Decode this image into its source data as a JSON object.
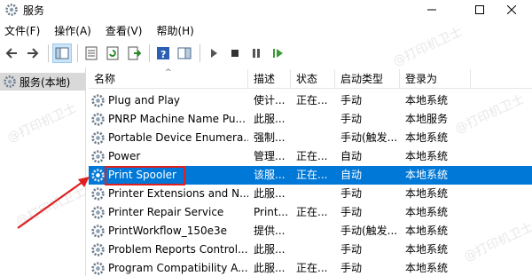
{
  "window": {
    "title": "服务"
  },
  "menubar": {
    "items": [
      "文件(F)",
      "操作(A)",
      "查看(V)",
      "帮助(H)"
    ]
  },
  "sidebar": {
    "selected": "服务(本地)"
  },
  "table": {
    "columns": [
      "名称",
      "描述",
      "状态",
      "启动类型",
      "登录为"
    ],
    "rows": [
      {
        "name": "Plug and Play",
        "desc": "使计...",
        "status": "正在...",
        "startup": "手动",
        "logon": "本地系统"
      },
      {
        "name": "PNRP Machine Name Pu...",
        "desc": "此服...",
        "status": "",
        "startup": "手动",
        "logon": "本地服务"
      },
      {
        "name": "Portable Device Enumera...",
        "desc": "强制...",
        "status": "",
        "startup": "手动(触发...",
        "logon": "本地系统"
      },
      {
        "name": "Power",
        "desc": "管理...",
        "status": "正在...",
        "startup": "自动",
        "logon": "本地系统"
      },
      {
        "name": "Print Spooler",
        "desc": "该服...",
        "status": "正在...",
        "startup": "自动",
        "logon": "本地系统",
        "selected": true
      },
      {
        "name": "Printer Extensions and N...",
        "desc": "此服...",
        "status": "",
        "startup": "手动",
        "logon": "本地系统"
      },
      {
        "name": "Printer Repair Service",
        "desc": "Print...",
        "status": "正在...",
        "startup": "手动",
        "logon": "本地系统"
      },
      {
        "name": "PrintWorkflow_150e3e",
        "desc": "提供...",
        "status": "",
        "startup": "手动(触发...",
        "logon": "本地系统"
      },
      {
        "name": "Problem Reports Control...",
        "desc": "此服...",
        "status": "",
        "startup": "手动",
        "logon": "本地系统"
      },
      {
        "name": "Program Compatibility A...",
        "desc": "此服...",
        "status": "正在...",
        "startup": "手动",
        "logon": "本地系统"
      }
    ]
  },
  "watermark": "@打印机卫士",
  "colors": {
    "selection": "#0078d7",
    "annotation": "#e02020"
  }
}
